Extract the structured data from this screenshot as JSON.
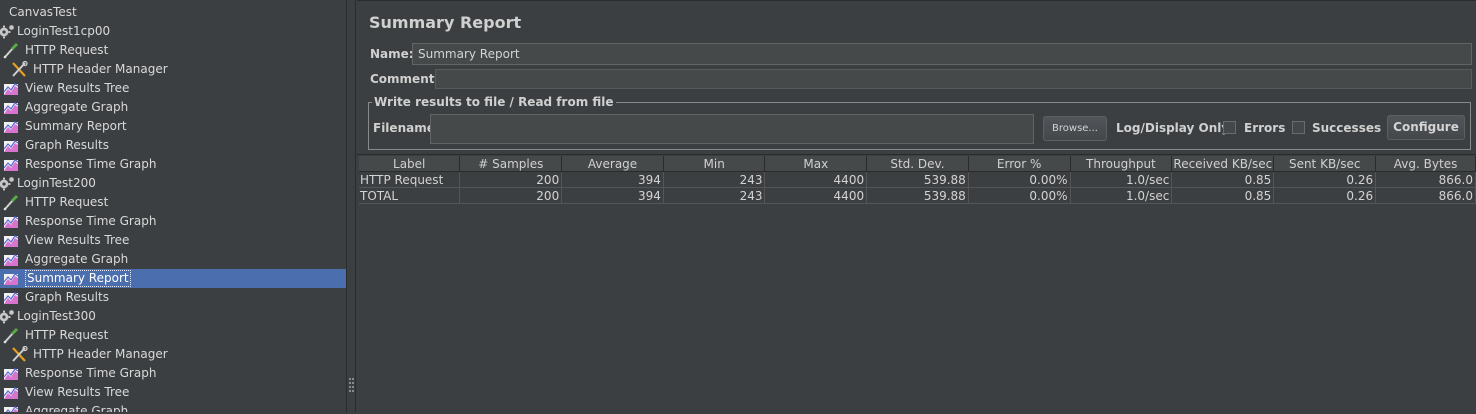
{
  "tree": {
    "items": [
      {
        "label": "CanvasTest",
        "icon": "none",
        "level": 0
      },
      {
        "label": "LoginTest1cp00",
        "icon": "gear-icon",
        "level": 0
      },
      {
        "label": "HTTP Request",
        "icon": "pipette-icon",
        "level": 1
      },
      {
        "label": "HTTP Header Manager",
        "icon": "tools-icon",
        "level": 2
      },
      {
        "label": "View Results Tree",
        "icon": "chart-icon",
        "level": 1
      },
      {
        "label": "Aggregate Graph",
        "icon": "chart-icon",
        "level": 1
      },
      {
        "label": "Summary Report",
        "icon": "chart-icon",
        "level": 1
      },
      {
        "label": "Graph Results",
        "icon": "chart-icon",
        "level": 1
      },
      {
        "label": "Response Time Graph",
        "icon": "chart-icon",
        "level": 1
      },
      {
        "label": "LoginTest200",
        "icon": "gear-icon",
        "level": 0
      },
      {
        "label": "HTTP Request",
        "icon": "pipette-icon",
        "level": 1
      },
      {
        "label": "Response Time Graph",
        "icon": "chart-icon",
        "level": 1
      },
      {
        "label": "View Results Tree",
        "icon": "chart-icon",
        "level": 1
      },
      {
        "label": "Aggregate Graph",
        "icon": "chart-icon",
        "level": 1
      },
      {
        "label": "Summary Report",
        "icon": "chart-icon",
        "level": 1,
        "selected": true
      },
      {
        "label": "Graph Results",
        "icon": "chart-icon",
        "level": 1
      },
      {
        "label": "LoginTest300",
        "icon": "gear-icon",
        "level": 0
      },
      {
        "label": "HTTP Request",
        "icon": "pipette-icon",
        "level": 1
      },
      {
        "label": "HTTP Header Manager",
        "icon": "tools-icon",
        "level": 2
      },
      {
        "label": "Response Time Graph",
        "icon": "chart-icon",
        "level": 1
      },
      {
        "label": "View Results Tree",
        "icon": "chart-icon",
        "level": 1
      },
      {
        "label": "Aggregate Graph",
        "icon": "chart-icon",
        "level": 1
      }
    ]
  },
  "main": {
    "title": "Summary Report",
    "name_label": "Name:",
    "name_value": "Summary Report",
    "comments_label": "Comments:",
    "file_legend": "Write results to file / Read from file",
    "filename_label": "Filename",
    "filename_value": "",
    "browse_label": "Browse...",
    "log_display_label": "Log/Display Only:",
    "errors_label": "Errors",
    "successes_label": "Successes",
    "configure_label": "Configure"
  },
  "table": {
    "columns": [
      "Label",
      "# Samples",
      "Average",
      "Min",
      "Max",
      "Std. Dev.",
      "Error %",
      "Throughput",
      "Received KB/sec",
      "Sent KB/sec",
      "Avg. Bytes"
    ],
    "rows": [
      [
        "HTTP Request",
        "200",
        "394",
        "243",
        "4400",
        "539.88",
        "0.00%",
        "1.0/sec",
        "0.85",
        "0.26",
        "866.0"
      ],
      [
        "TOTAL",
        "200",
        "394",
        "243",
        "4400",
        "539.88",
        "0.00%",
        "1.0/sec",
        "0.85",
        "0.26",
        "866.0"
      ]
    ]
  },
  "colors": {
    "background": "#3c3f41",
    "selection": "#4b6eaf",
    "input_background": "#45494a"
  }
}
